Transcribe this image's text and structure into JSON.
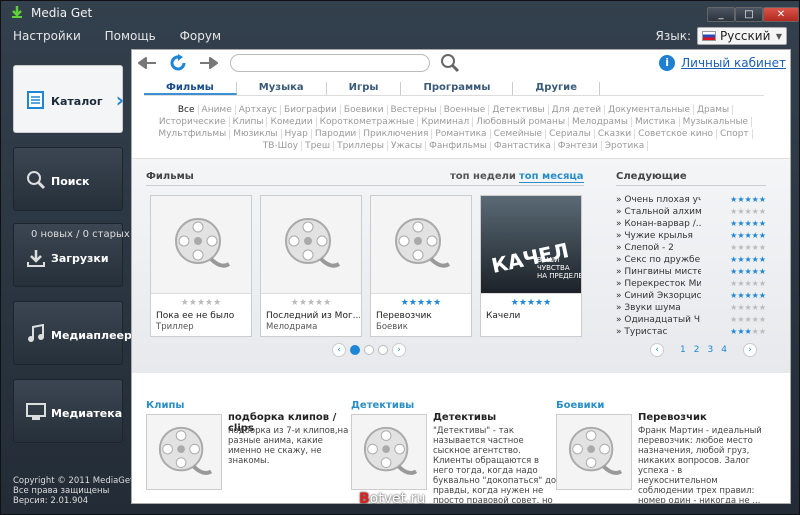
{
  "window": {
    "title": "Media Get",
    "controls": [
      "_",
      "□",
      "✕"
    ]
  },
  "menu": [
    "Настройки",
    "Помощь",
    "Форум"
  ],
  "language": {
    "label": "Язык:",
    "selected": "Русский"
  },
  "sidebar": {
    "items": [
      {
        "id": "catalog",
        "label": "Каталог",
        "icon": "catalog-icon"
      },
      {
        "id": "search",
        "label": "Поиск",
        "icon": "magnifier-icon"
      },
      {
        "id": "downloads",
        "label": "Загрузки",
        "icon": "download-icon"
      },
      {
        "id": "mediaplayer",
        "label": "Медиаплеер",
        "icon": "music-note-icon"
      },
      {
        "id": "medialib",
        "label": "Медиатека",
        "icon": "monitor-icon"
      }
    ],
    "downloads_count": "0 новых / 0 старых",
    "copyright": [
      "Copyright © 2011 MediaGet2",
      "Все права защищены",
      "Версия: 2.01.904"
    ]
  },
  "toolbar": {
    "search_value": "",
    "cabinet_label": "Личный кабинет"
  },
  "categories": [
    "Фильмы",
    "Музыка",
    "Игры",
    "Программы",
    "Другие"
  ],
  "genres_rows": [
    [
      "Все",
      "Аниме",
      "Артхаус",
      "Биографии",
      "Боевики",
      "Вестерны",
      "Военные",
      "Детективы",
      "Для детей",
      "Документальные",
      "Драмы"
    ],
    [
      "Исторические",
      "Клипы",
      "Комедии",
      "Короткометражные",
      "Криминал",
      "Любовный романы",
      "Мелодрамы",
      "Мистика",
      "Музыкальные"
    ],
    [
      "Мультфильмы",
      "Мюзиклы",
      "Нуар",
      "Пародии",
      "Приключения",
      "Романтика",
      "Семейные",
      "Сериалы",
      "Сказки",
      "Советское кино",
      "Спорт"
    ],
    [
      "ТВ-Шоу",
      "Треш",
      "Триллеры",
      "Ужасы",
      "Фанфильмы",
      "Фантастика",
      "Фэнтези",
      "Эротика"
    ]
  ],
  "films_panel": {
    "title": "Фильмы",
    "tabs": [
      "топ недели",
      "топ месяца"
    ],
    "films": [
      {
        "title": "Пока ее не было",
        "genre": "Триллер",
        "rating": 0,
        "poster": "film-reel"
      },
      {
        "title": "Последний из Мог...",
        "genre": "Мелодрама",
        "rating": 0,
        "poster": "film-reel"
      },
      {
        "title": "Перевозчик",
        "genre": "Боевик",
        "rating": 5,
        "poster": "film-reel"
      },
      {
        "title": "Качели",
        "genre": "",
        "rating": 5,
        "poster": "movie-poster"
      }
    ],
    "poster_text": {
      "line1": "КАЧЕЛ",
      "line2": "ВАШИ\nЧУВСТВА\nНА ПРЕДЕЛЕ"
    },
    "pager_pages": 4,
    "pager_current": 1
  },
  "next_panel": {
    "title": "Следующие",
    "items": [
      {
        "title": "» Очень плохая уча...",
        "rating": 5
      },
      {
        "title": "» Стальной алхим...",
        "rating": 0
      },
      {
        "title": "» Конан-варвар /...",
        "rating": 5
      },
      {
        "title": "» Чужие крылья",
        "rating": 5
      },
      {
        "title": "» Слепой - 2",
        "rating": 0
      },
      {
        "title": "» Секс по дружбе",
        "rating": 5
      },
      {
        "title": "» Пингвины мисте...",
        "rating": 5
      },
      {
        "title": "» Перекресток Ми...",
        "rating": 0
      },
      {
        "title": "» Синий Экзорцис...",
        "rating": 5
      },
      {
        "title": "» Звуки шума",
        "rating": 0
      },
      {
        "title": "» Одинадцатый Ч...",
        "rating": 0
      },
      {
        "title": "» Туристас",
        "rating": 3
      }
    ],
    "pages": [
      "1",
      "2",
      "3",
      "4"
    ]
  },
  "bottom": [
    {
      "category": "Клипы",
      "title": "подборка клипов / clips",
      "text": "подборка из 7-и клипов,на разные анима, какие именно не скажу, не знакомы."
    },
    {
      "category": "Детективы",
      "title": "Детективы",
      "text": "\"Детективы\" - так называется частное сыскное агентство. Клиенты обращаются в него тогда, когда надо буквально \"докопаться\" до правды, когда нужен не просто правовой совет, но активная помощь. И ..."
    },
    {
      "category": "Боевики",
      "title": "Перевозчик",
      "text": "Франк Мартин - идеальный перевозчик: любое место назначения, любой груз, никаких вопросов. Залог успеха - в неукоснительном соблюдении трех правил: номер один - никогда не ..."
    }
  ],
  "watermark": {
    "prefix": "B",
    "rest": "otvet.ru"
  },
  "colors": {
    "accent": "#1e86d6",
    "window_bg": "#2b3541"
  }
}
